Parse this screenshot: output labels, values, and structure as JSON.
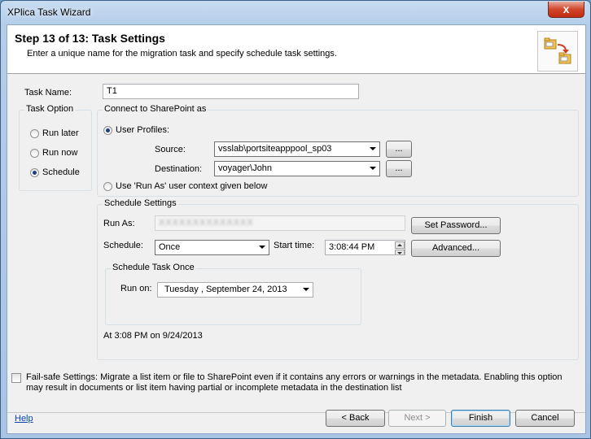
{
  "window": {
    "title": "XPlica Task Wizard",
    "close_glyph": "x"
  },
  "header": {
    "step_title": "Step 13 of 13: Task Settings",
    "subtitle": "Enter a unique name for the migration task and specify schedule task settings."
  },
  "task_name": {
    "label": "Task Name:",
    "value": "T1"
  },
  "task_option": {
    "title": "Task Option",
    "options": [
      {
        "label": "Run later",
        "checked": false
      },
      {
        "label": "Run now",
        "checked": false
      },
      {
        "label": "Schedule",
        "checked": true
      }
    ]
  },
  "connect": {
    "title": "Connect to SharePoint as",
    "user_profiles_label": "User Profiles:",
    "user_profiles_checked": true,
    "source_label": "Source:",
    "source_value": "vsslab\\portsiteapppool_sp03",
    "destination_label": "Destination:",
    "destination_value": "voyager\\John",
    "browse_label": "...",
    "run_as_label": "Use 'Run As' user context given below",
    "run_as_checked": false
  },
  "schedule": {
    "title": "Schedule Settings",
    "run_as_label": "Run As:",
    "run_as_value": "XXXXXXXXXXXXXX",
    "set_password_label": "Set Password...",
    "schedule_label": "Schedule:",
    "schedule_value": "Once",
    "start_time_label": "Start time:",
    "start_time_value": "3:08:44 PM",
    "advanced_label": "Advanced...",
    "once_group_title": "Schedule Task Once",
    "run_on_label": "Run on:",
    "run_on_value": "Tuesday   , September 24, 2013",
    "summary": "At 3:08 PM on 9/24/2013"
  },
  "failsafe": {
    "checked": false,
    "line1": "Fail-safe Settings: Migrate a list item or file to SharePoint even if it contains any errors or warnings in the metadata. Enabling this option",
    "line2": "may result in documents or list item having partial or incomplete metadata in the destination list"
  },
  "footer": {
    "help_label": "Help",
    "back_label": "< Back",
    "next_label": "Next >",
    "finish_label": "Finish",
    "cancel_label": "Cancel"
  }
}
